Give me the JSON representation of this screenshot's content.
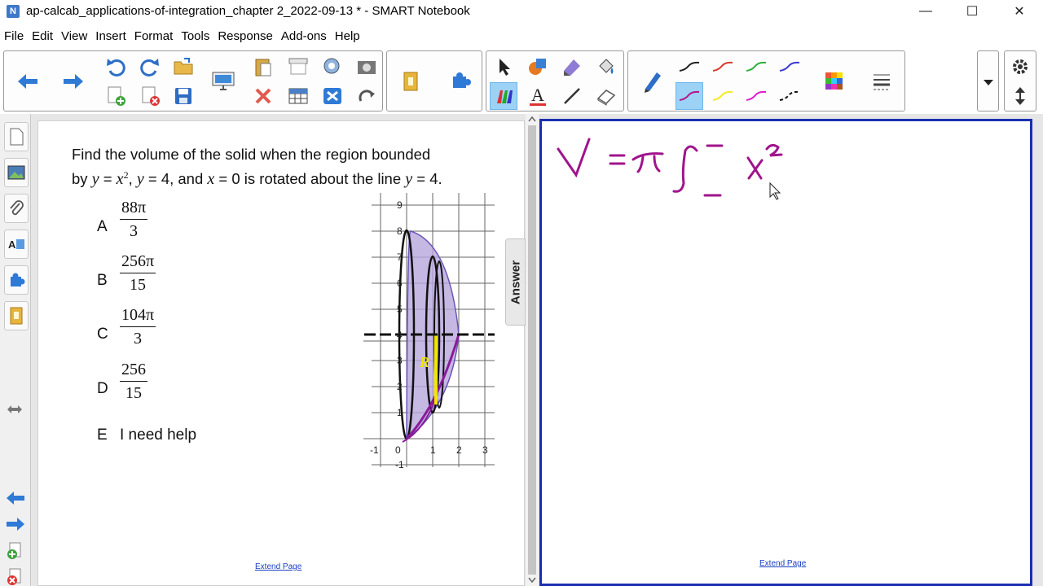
{
  "window": {
    "title": "ap-calcab_applications-of-integration_chapter 2_2022-09-13 * - SMART Notebook",
    "minimize_glyph": "—",
    "maximize_glyph": "☐",
    "close_glyph": "✕"
  },
  "menu": [
    "File",
    "Edit",
    "View",
    "Insert",
    "Format",
    "Tools",
    "Response",
    "Add-ons",
    "Help"
  ],
  "toolbar": {
    "icons": [
      "back-arrow-icon",
      "forward-arrow-icon",
      "undo-icon",
      "redo-icon",
      "open-icon",
      "new-page-icon",
      "delete-page-icon",
      "save-icon",
      "paste-icon",
      "screen-shade-icon",
      "display-icon",
      "delete-icon",
      "table-icon",
      "capture-icon",
      "fullscreen-icon",
      "gallery-icon",
      "addons-icon",
      "select-icon",
      "shapes-icon",
      "magic-pen-icon",
      "fill-icon",
      "pens-icon",
      "text-icon",
      "line-icon",
      "eraser-icon",
      "pen-icon",
      "color-palette-icon",
      "line-properties-icon",
      "settings-gear-icon",
      "move-toolbar-icon"
    ],
    "pen_colors": [
      "#222222",
      "#d93a2b",
      "#2bb03a",
      "#3a3ad0",
      "#b5158a",
      "#f6ea1e",
      "#e21ad0",
      "#111111"
    ]
  },
  "question": {
    "line1": "Find the volume of the solid when the region bounded",
    "line2_a": "by ",
    "line2_y1": "y",
    "line2_eq1": " = ",
    "line2_x2": "x",
    "line2_exp": "2",
    "line2_b": ", ",
    "line2_y2": "y",
    "line2_c": " = 4, and ",
    "line2_x0": "x",
    "line2_d": " = 0 is rotated about the line ",
    "line2_y3": "y",
    "line2_e": " = 4."
  },
  "options": [
    {
      "letter": "A",
      "num": "88π",
      "den": "3"
    },
    {
      "letter": "B",
      "num": "256π",
      "den": "15"
    },
    {
      "letter": "C",
      "num": "104π",
      "den": "3"
    },
    {
      "letter": "D",
      "num": "256",
      "den": "15"
    },
    {
      "letter": "E",
      "text": "I need help"
    }
  ],
  "graph": {
    "x_ticks": [
      "-1",
      "0",
      "1",
      "2",
      "3"
    ],
    "y_ticks": [
      "9",
      "8",
      "7",
      "6",
      "5",
      "4",
      "3",
      "2",
      "1",
      "-1"
    ],
    "radius_label": "R",
    "fill_color": "#b7a6dc",
    "curve_color": "#8a1a9a",
    "radius_color": "#f2e600"
  },
  "answer_tab": "Answer",
  "extend_left": "Extend Page",
  "extend_right": "Extend Page",
  "ink_color": "#a0148c"
}
